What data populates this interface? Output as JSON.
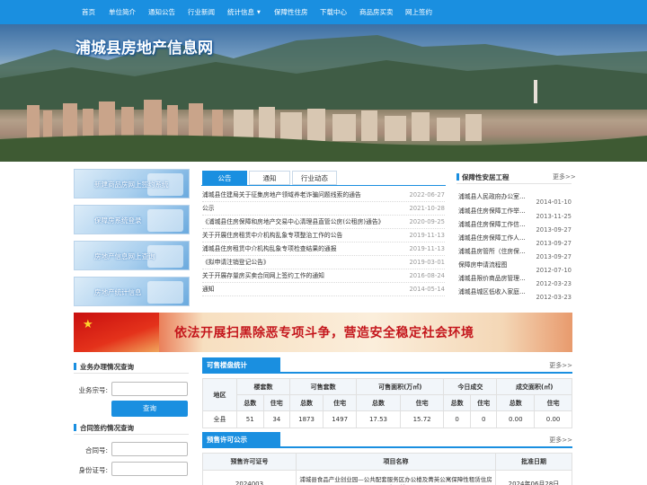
{
  "nav": {
    "items": [
      "首页",
      "单位简介",
      "通知公告",
      "行业新闻",
      "统计信息",
      "保障性住房",
      "下载中心",
      "商品房买卖",
      "网上签约"
    ],
    "dropdown_caret": "▼"
  },
  "banner": {
    "title": "浦城县房地产信息网"
  },
  "quick_links": [
    "新建商品房网上签约系统",
    "保障房系统登录",
    "房地产信息网上查询",
    "房地产统计信息"
  ],
  "tabs": [
    "公告",
    "通知",
    "行业动态"
  ],
  "news": [
    {
      "title": "浦城县住建局关于征集房地产领域养老诈骗问题线索的通告",
      "date": "2022-06-27"
    },
    {
      "title": "公示",
      "date": "2021-10-28"
    },
    {
      "title": "《浦城县住房保障和房地产交易中心清理县直管公房(公租房)通告》",
      "date": "2020-09-25"
    },
    {
      "title": "关于开展住房租赁中介机构乱象专项整治工作的公告",
      "date": "2019-11-13"
    },
    {
      "title": "浦城县住房租赁中介机构乱象专项检查结果的通报",
      "date": "2019-11-13"
    },
    {
      "title": "《拟申请注销登记公告》",
      "date": "2019-03-01"
    },
    {
      "title": "关于开展存量房买卖合同网上签约工作的通知",
      "date": "2016-08-24"
    },
    {
      "title": "通知",
      "date": "2014-05-14"
    }
  ],
  "housing_security": {
    "title": "保障性安居工程",
    "more": "更多>>",
    "items": [
      {
        "title": "浦城县人民政府办公室…",
        "date": "2014-01-10"
      },
      {
        "title": "浦城县住房保障工作举…",
        "date": "2013-11-25"
      },
      {
        "title": "浦城县住房保障工作信…",
        "date": "2013-09-27"
      },
      {
        "title": "浦城县住房保障工作人…",
        "date": "2013-09-27"
      },
      {
        "title": "浦城县房管所（住房保…",
        "date": "2013-09-27"
      },
      {
        "title": "保障房申请流程图",
        "date": "2012-07-10"
      },
      {
        "title": "浦城县限价商品房管理…",
        "date": "2012-03-23"
      },
      {
        "title": "浦城县城区低收入家庭…",
        "date": "2012-03-23"
      }
    ]
  },
  "slogan": {
    "text": "依法开展扫黑除恶专项斗争，营造安全稳定社会环境",
    "star": "★"
  },
  "business_query": {
    "title": "业务办理情况查询",
    "label": "业务宗号:",
    "input_value": "",
    "button": "查询"
  },
  "contract_query": {
    "title": "合同签约情况查询",
    "labels": [
      "合同号:",
      "身份证号:"
    ],
    "input_values": [
      "",
      ""
    ]
  },
  "sale_stats": {
    "title": "可售楼盘统计",
    "more": "更多>>",
    "group_headers": [
      "地区",
      "楼套数",
      "可售套数",
      "可售面积(万㎡)",
      "今日成交",
      "成交面积(㎡)"
    ],
    "sub_headers": [
      "总数",
      "住宅",
      "总数",
      "住宅",
      "总数",
      "住宅",
      "总数",
      "住宅",
      "总数",
      "住宅"
    ],
    "row": [
      "全县",
      "51",
      "34",
      "1873",
      "1497",
      "17.53",
      "15.72",
      "0",
      "0",
      "0.00",
      "0.00"
    ]
  },
  "presale": {
    "title": "预售许可公示",
    "more": "更多>>",
    "headers": [
      "预售许可证号",
      "项目名称",
      "批准日期"
    ],
    "row": [
      "2024003",
      "浦城县食品产业创业园—公共配套服务区办公楼及菁英公寓保障性租赁住房（1#楼",
      "2024年06月28日"
    ]
  },
  "colors": {
    "primary": "#1a8fe0",
    "slogan_red": "#c4161c"
  }
}
